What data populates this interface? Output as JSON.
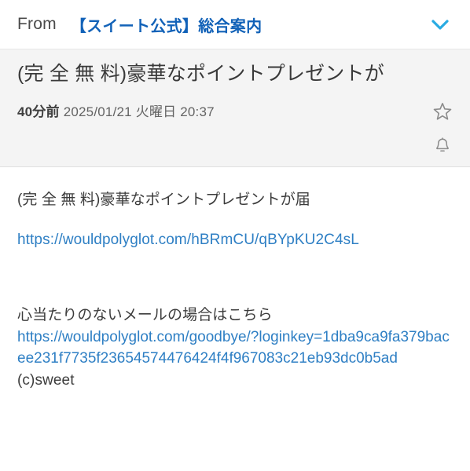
{
  "header": {
    "from_label": "From",
    "sender_name": "【スイート公式】総合案内",
    "expand_icon": "chevron-down-icon",
    "sender_color": "#1262b8",
    "chevron_color": "#29abe2"
  },
  "subject_band": {
    "subject": "(完 全 無 料)豪華なポイントプレゼントが",
    "time_ago": "40分前",
    "datetime": "2025/01/21 火曜日 20:37",
    "star_icon": "star-outline-icon",
    "bell_icon": "bell-outline-icon",
    "background": "#f4f4f4"
  },
  "body": {
    "preview_text": "(完 全 無 料)豪華なポイントプレゼントが届",
    "main_link": "https://wouldpolyglot.com/hBRmCU/qBYpKU2C4sL",
    "unsubscribe_note": "心当たりのないメールの場合はこちら",
    "unsubscribe_link": "https://wouldpolyglot.com/goodbye/?loginkey=1dba9ca9fa379bacee231f7735f23654574476424f4f967083c21eb93dc0b5ad",
    "signature": "(c)sweet",
    "link_color": "#2e7fc4"
  }
}
